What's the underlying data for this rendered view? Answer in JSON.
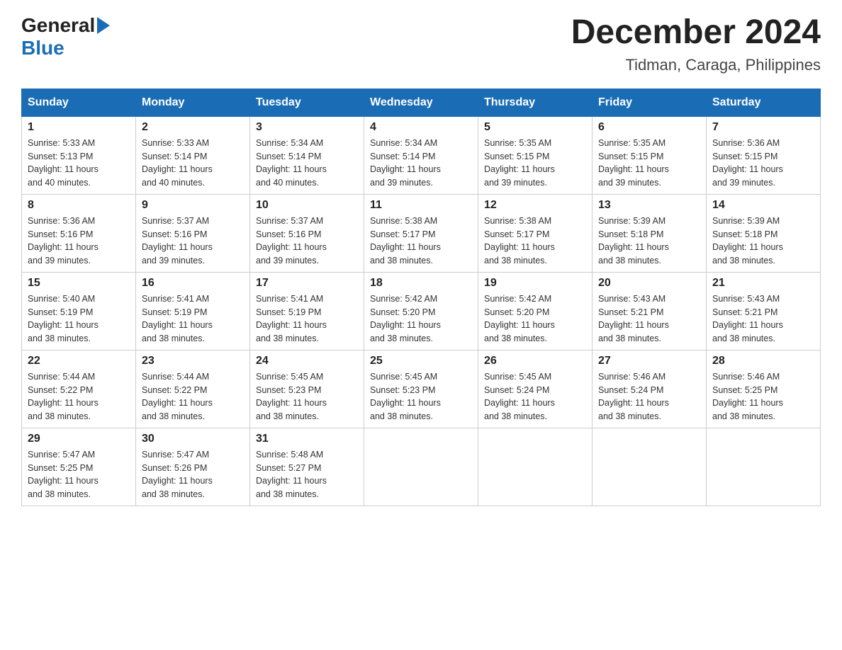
{
  "header": {
    "logo_general": "General",
    "logo_blue": "Blue",
    "month_title": "December 2024",
    "location": "Tidman, Caraga, Philippines"
  },
  "days_of_week": [
    "Sunday",
    "Monday",
    "Tuesday",
    "Wednesday",
    "Thursday",
    "Friday",
    "Saturday"
  ],
  "weeks": [
    [
      {
        "day": "1",
        "sunrise": "5:33 AM",
        "sunset": "5:13 PM",
        "daylight": "11 hours and 40 minutes."
      },
      {
        "day": "2",
        "sunrise": "5:33 AM",
        "sunset": "5:14 PM",
        "daylight": "11 hours and 40 minutes."
      },
      {
        "day": "3",
        "sunrise": "5:34 AM",
        "sunset": "5:14 PM",
        "daylight": "11 hours and 40 minutes."
      },
      {
        "day": "4",
        "sunrise": "5:34 AM",
        "sunset": "5:14 PM",
        "daylight": "11 hours and 39 minutes."
      },
      {
        "day": "5",
        "sunrise": "5:35 AM",
        "sunset": "5:15 PM",
        "daylight": "11 hours and 39 minutes."
      },
      {
        "day": "6",
        "sunrise": "5:35 AM",
        "sunset": "5:15 PM",
        "daylight": "11 hours and 39 minutes."
      },
      {
        "day": "7",
        "sunrise": "5:36 AM",
        "sunset": "5:15 PM",
        "daylight": "11 hours and 39 minutes."
      }
    ],
    [
      {
        "day": "8",
        "sunrise": "5:36 AM",
        "sunset": "5:16 PM",
        "daylight": "11 hours and 39 minutes."
      },
      {
        "day": "9",
        "sunrise": "5:37 AM",
        "sunset": "5:16 PM",
        "daylight": "11 hours and 39 minutes."
      },
      {
        "day": "10",
        "sunrise": "5:37 AM",
        "sunset": "5:16 PM",
        "daylight": "11 hours and 39 minutes."
      },
      {
        "day": "11",
        "sunrise": "5:38 AM",
        "sunset": "5:17 PM",
        "daylight": "11 hours and 38 minutes."
      },
      {
        "day": "12",
        "sunrise": "5:38 AM",
        "sunset": "5:17 PM",
        "daylight": "11 hours and 38 minutes."
      },
      {
        "day": "13",
        "sunrise": "5:39 AM",
        "sunset": "5:18 PM",
        "daylight": "11 hours and 38 minutes."
      },
      {
        "day": "14",
        "sunrise": "5:39 AM",
        "sunset": "5:18 PM",
        "daylight": "11 hours and 38 minutes."
      }
    ],
    [
      {
        "day": "15",
        "sunrise": "5:40 AM",
        "sunset": "5:19 PM",
        "daylight": "11 hours and 38 minutes."
      },
      {
        "day": "16",
        "sunrise": "5:41 AM",
        "sunset": "5:19 PM",
        "daylight": "11 hours and 38 minutes."
      },
      {
        "day": "17",
        "sunrise": "5:41 AM",
        "sunset": "5:19 PM",
        "daylight": "11 hours and 38 minutes."
      },
      {
        "day": "18",
        "sunrise": "5:42 AM",
        "sunset": "5:20 PM",
        "daylight": "11 hours and 38 minutes."
      },
      {
        "day": "19",
        "sunrise": "5:42 AM",
        "sunset": "5:20 PM",
        "daylight": "11 hours and 38 minutes."
      },
      {
        "day": "20",
        "sunrise": "5:43 AM",
        "sunset": "5:21 PM",
        "daylight": "11 hours and 38 minutes."
      },
      {
        "day": "21",
        "sunrise": "5:43 AM",
        "sunset": "5:21 PM",
        "daylight": "11 hours and 38 minutes."
      }
    ],
    [
      {
        "day": "22",
        "sunrise": "5:44 AM",
        "sunset": "5:22 PM",
        "daylight": "11 hours and 38 minutes."
      },
      {
        "day": "23",
        "sunrise": "5:44 AM",
        "sunset": "5:22 PM",
        "daylight": "11 hours and 38 minutes."
      },
      {
        "day": "24",
        "sunrise": "5:45 AM",
        "sunset": "5:23 PM",
        "daylight": "11 hours and 38 minutes."
      },
      {
        "day": "25",
        "sunrise": "5:45 AM",
        "sunset": "5:23 PM",
        "daylight": "11 hours and 38 minutes."
      },
      {
        "day": "26",
        "sunrise": "5:45 AM",
        "sunset": "5:24 PM",
        "daylight": "11 hours and 38 minutes."
      },
      {
        "day": "27",
        "sunrise": "5:46 AM",
        "sunset": "5:24 PM",
        "daylight": "11 hours and 38 minutes."
      },
      {
        "day": "28",
        "sunrise": "5:46 AM",
        "sunset": "5:25 PM",
        "daylight": "11 hours and 38 minutes."
      }
    ],
    [
      {
        "day": "29",
        "sunrise": "5:47 AM",
        "sunset": "5:25 PM",
        "daylight": "11 hours and 38 minutes."
      },
      {
        "day": "30",
        "sunrise": "5:47 AM",
        "sunset": "5:26 PM",
        "daylight": "11 hours and 38 minutes."
      },
      {
        "day": "31",
        "sunrise": "5:48 AM",
        "sunset": "5:27 PM",
        "daylight": "11 hours and 38 minutes."
      },
      null,
      null,
      null,
      null
    ]
  ],
  "labels": {
    "sunrise": "Sunrise:",
    "sunset": "Sunset:",
    "daylight": "Daylight:"
  }
}
